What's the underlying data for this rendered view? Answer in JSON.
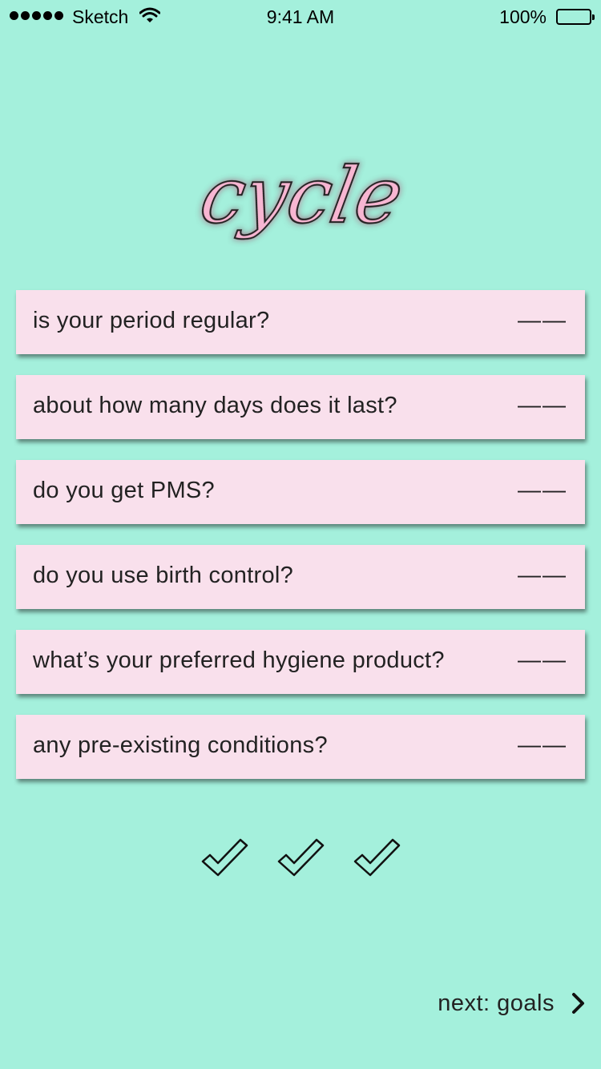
{
  "status_bar": {
    "carrier": "Sketch",
    "time": "9:41 AM",
    "battery": "100%"
  },
  "app": {
    "logo_text": "cycle"
  },
  "questions": [
    {
      "label": "is your period regular?",
      "answer": "——"
    },
    {
      "label": "about how many days does it last?",
      "answer": "——"
    },
    {
      "label": "do you get PMS?",
      "answer": "——"
    },
    {
      "label": "do you use birth control?",
      "answer": "——"
    },
    {
      "label": "what’s your preferred hygiene product?",
      "answer": "——"
    },
    {
      "label": "any pre-existing conditions?",
      "answer": "——"
    }
  ],
  "progress": {
    "icons": [
      "checkmark-icon",
      "checkmark-icon",
      "checkmark-icon"
    ]
  },
  "footer": {
    "next_label": "next: goals",
    "next_icon": "chevron-right-icon"
  },
  "colors": {
    "background": "#a4f0dc",
    "card": "#f9e0ec",
    "logo_fill": "#f7b6d2",
    "text": "#1e1e1e"
  }
}
